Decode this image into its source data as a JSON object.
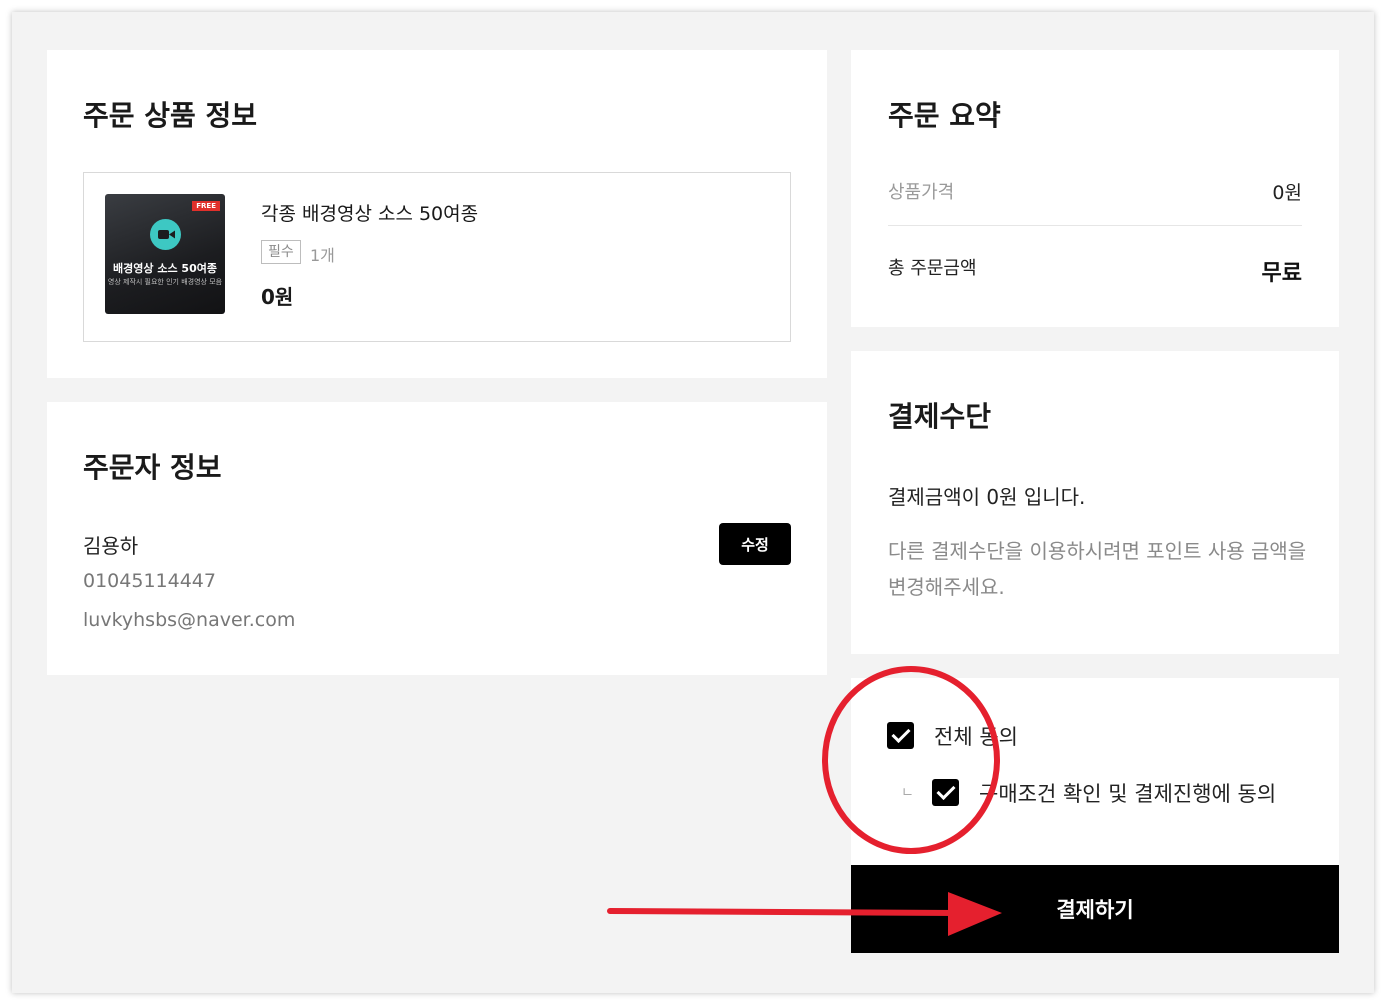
{
  "order_product": {
    "title": "주문 상품 정보",
    "product": {
      "name": "각종 배경영상 소스 50여종",
      "tag": "필수",
      "quantity": "1개",
      "price": "0원",
      "thumbnail": {
        "badge": "FREE",
        "title": "배경영상 소스 50여종",
        "subtitle": "영상 제작시 필요한 인기 배경영상 모음",
        "icon": "video-camera-icon"
      }
    }
  },
  "orderer": {
    "title": "주문자 정보",
    "name": "김용하",
    "phone": "01045114447",
    "email": "luvkyhsbs@naver.com",
    "edit_label": "수정"
  },
  "summary": {
    "title": "주문 요약",
    "product_price_label": "상품가격",
    "product_price_value": "0원",
    "total_label": "총 주문금액",
    "total_value": "무료"
  },
  "payment": {
    "title": "결제수단",
    "amount_text": "결제금액이 0원 입니다.",
    "note": "다른 결제수단을 이용하시려면 포인트 사용 금액을 변경해주세요."
  },
  "agreement": {
    "all_label": "전체 동의",
    "all_checked": true,
    "sub_label": "구매조건 확인 및 결제진행에 동의",
    "sub_checked": true,
    "sub_mark": "ㄴ"
  },
  "pay_button": {
    "label": "결제하기"
  },
  "colors": {
    "background": "#f3f3f3",
    "card": "#ffffff",
    "primary": "#000000",
    "annotation": "#e5202e",
    "thumbnail_icon": "#3dc8c3"
  }
}
